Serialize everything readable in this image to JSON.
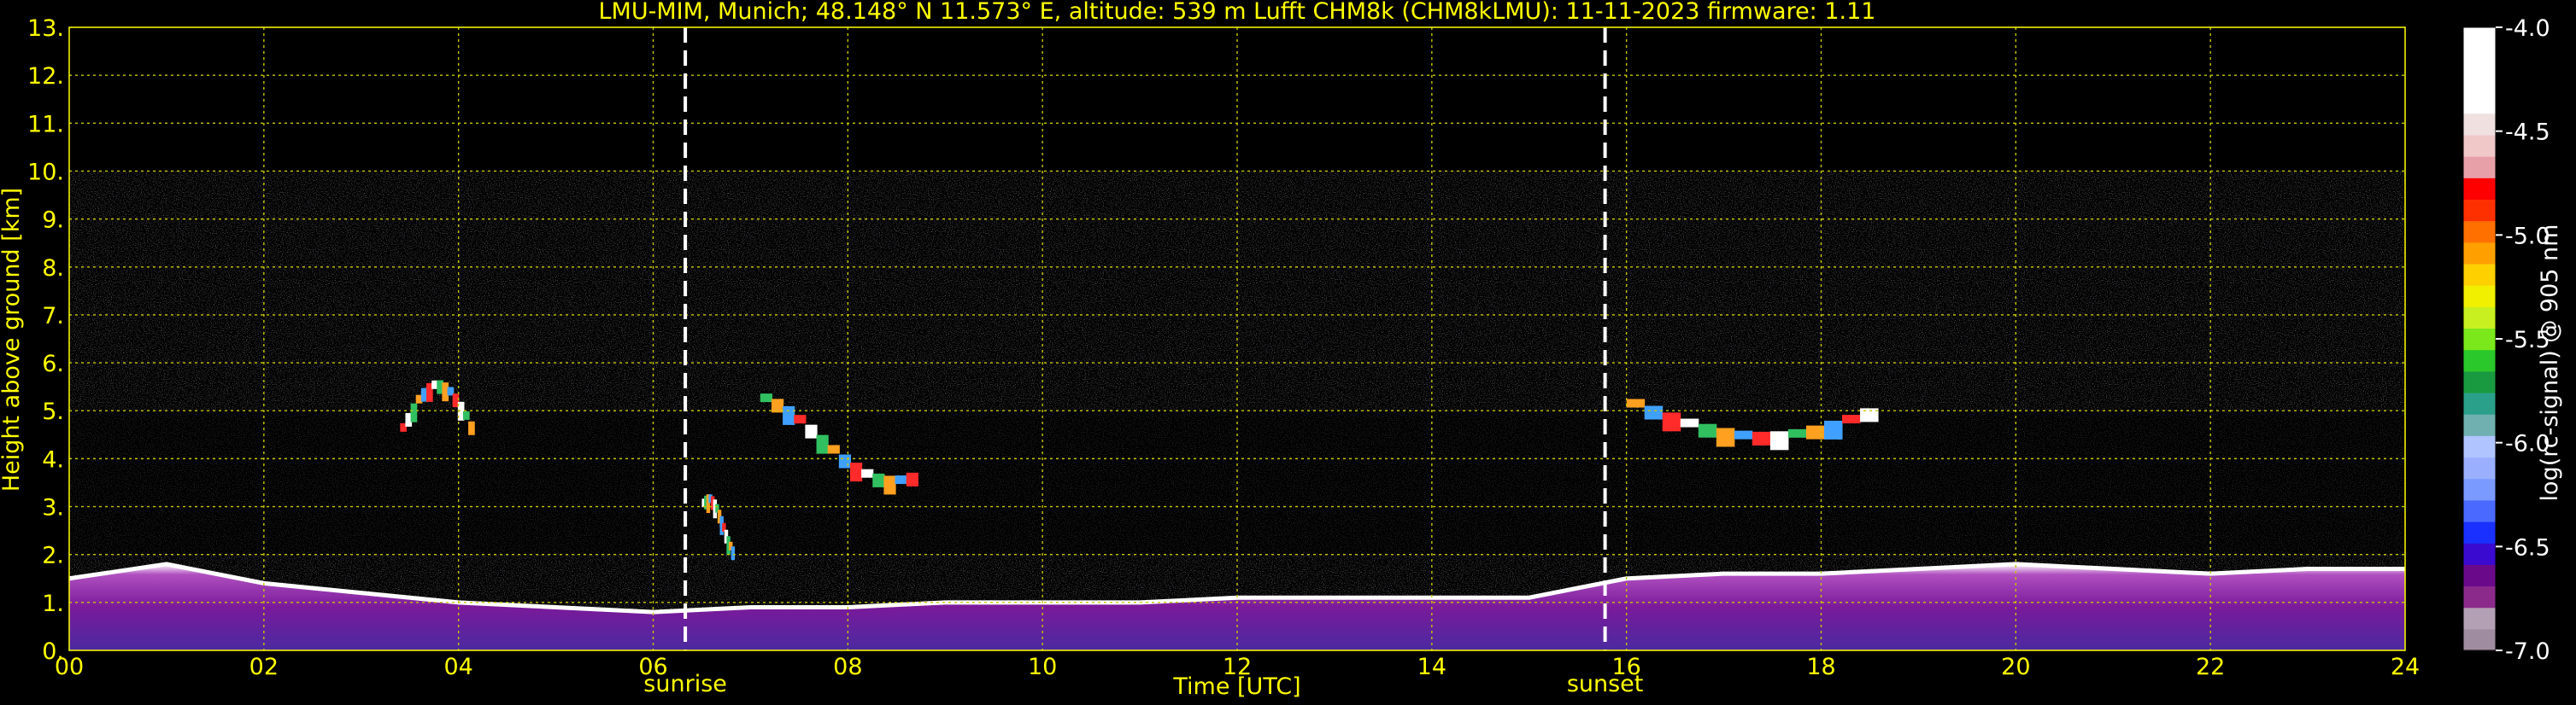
{
  "chart_data": {
    "type": "heatmap",
    "title": "LMU-MIM, Munich; 48.148° N 11.573° E, altitude: 539 m    Lufft CHM8k (CHM8kLMU): 11-11-2023    firmware: 1.11",
    "xlabel": "Time [UTC]",
    "ylabel": "Height above ground [km]",
    "xlim": [
      0,
      24
    ],
    "ylim": [
      0,
      13
    ],
    "x_ticks": [
      "00",
      "02",
      "04",
      "06",
      "08",
      "10",
      "12",
      "14",
      "16",
      "18",
      "20",
      "22",
      "24"
    ],
    "y_ticks": [
      "0.",
      "1.",
      "2.",
      "3.",
      "4.",
      "5.",
      "6.",
      "7.",
      "8.",
      "9.",
      "10.",
      "11.",
      "12.",
      "13."
    ],
    "grid": true,
    "annotations": [
      {
        "label": "sunrise",
        "x": 6.33
      },
      {
        "label": "sunset",
        "x": 15.78
      }
    ],
    "signal_top_km": 10,
    "colorbar": {
      "label": "log(rc-signal) @ 905 nm",
      "ticks": [
        "-4.0",
        "-4.5",
        "-5.0",
        "-5.5",
        "-6.0",
        "-6.5",
        "-7.0"
      ],
      "range": [
        -7.0,
        -4.0
      ],
      "colors": [
        "#a08ca0",
        "#b4a0b4",
        "#8c2a8c",
        "#6a0a8a",
        "#3a0ad0",
        "#1a30ff",
        "#4a6aff",
        "#7a9aff",
        "#9ab0ff",
        "#b0c4ff",
        "#70b0b0",
        "#2aa08a",
        "#1a9a40",
        "#2ac82a",
        "#7ae81a",
        "#c8f020",
        "#f0f000",
        "#ffd000",
        "#ffa000",
        "#ff7000",
        "#ff3000",
        "#ff0000",
        "#e8a0a8",
        "#f0c8c8",
        "#f0e0e0",
        "#ffffff",
        "#ffffff",
        "#ffffff",
        "#ffffff"
      ]
    },
    "boundary_layer": [
      [
        0,
        1.5
      ],
      [
        1,
        1.8
      ],
      [
        2,
        1.4
      ],
      [
        3,
        1.2
      ],
      [
        4,
        1.0
      ],
      [
        5,
        0.9
      ],
      [
        6,
        0.8
      ],
      [
        7,
        0.9
      ],
      [
        8,
        0.9
      ],
      [
        9,
        1.0
      ],
      [
        10,
        1.0
      ],
      [
        11,
        1.0
      ],
      [
        12,
        1.1
      ],
      [
        13,
        1.1
      ],
      [
        14,
        1.1
      ],
      [
        15,
        1.1
      ],
      [
        16,
        1.5
      ],
      [
        17,
        1.6
      ],
      [
        18,
        1.6
      ],
      [
        19,
        1.7
      ],
      [
        20,
        1.8
      ],
      [
        21,
        1.7
      ],
      [
        22,
        1.6
      ],
      [
        23,
        1.7
      ],
      [
        24,
        1.7
      ]
    ],
    "cloud_layers": [
      {
        "x0": 3.4,
        "x1": 4.1,
        "y0": 4.2,
        "y1": 6.0
      },
      {
        "x0": 6.5,
        "x1": 6.8,
        "y0": 2.3,
        "y1": 3.5
      },
      {
        "x0": 7.1,
        "x1": 8.6,
        "y0": 4.0,
        "y1": 5.8
      },
      {
        "x0": 16.0,
        "x1": 18.4,
        "y0": 4.8,
        "y1": 6.0
      }
    ]
  }
}
